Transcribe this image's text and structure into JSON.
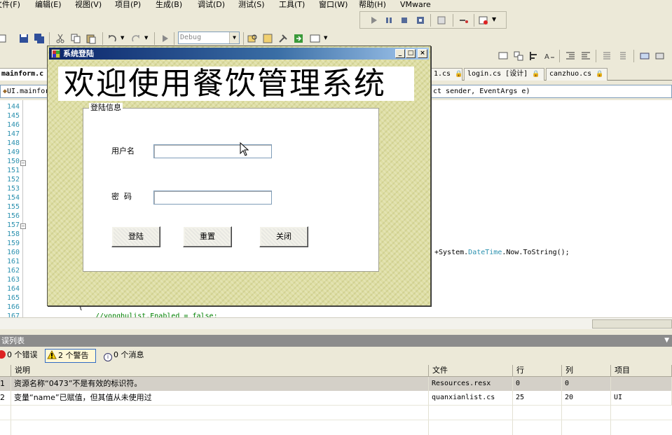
{
  "menu": {
    "items": [
      "文件(F)",
      "编辑(E)",
      "视图(V)",
      "项目(P)",
      "生成(B)",
      "调试(D)",
      "测试(S)",
      "工具(T)",
      "窗口(W)",
      "帮助(H)",
      "VMware"
    ]
  },
  "toolbar": {
    "config": "Debug"
  },
  "tabs": {
    "active": "mainform.c",
    "items": [
      "1.cs",
      "login.cs [设计]",
      "canzhuo.cs"
    ]
  },
  "nav": {
    "left": "UI.mainform",
    "right": "ct sender, EventArgs e)"
  },
  "editor": {
    "line_numbers": [
      "144",
      "145",
      "146",
      "147",
      "148",
      "149",
      "150",
      "151",
      "152",
      "153",
      "154",
      "155",
      "156",
      "157",
      "158",
      "159",
      "160",
      "161",
      "162",
      "163",
      "164",
      "165",
      "166",
      "167"
    ],
    "code_line_160_prefix": "+System.",
    "code_line_160_type": "DateTime",
    "code_line_160_mid": ".Now.ToString();",
    "code_brace": "{",
    "code_comment": "//yonghulist.Enabled = false;"
  },
  "errorlist": {
    "title": "误列表",
    "filters": {
      "errors": "0 个错误",
      "warnings": "2 个警告",
      "messages": "0 个消息"
    },
    "columns": [
      "",
      "说明",
      "文件",
      "行",
      "列",
      "项目"
    ],
    "rows": [
      {
        "num": "1",
        "desc": "资源名称“0473”不是有效的标识符。",
        "file": "Resources.resx",
        "line": "0",
        "col": "0",
        "project": ""
      },
      {
        "num": "2",
        "desc": "变量“name”已赋值，但其值从未使用过",
        "file": "quanxianlist.cs",
        "line": "25",
        "col": "20",
        "project": "UI"
      }
    ]
  },
  "dialog": {
    "title": "系统登陆",
    "banner": "欢迎使用餐饮管理系统",
    "group_label": "登陆信息",
    "username_label": "用户名",
    "password_label": "密  码",
    "username_value": "",
    "password_value": "",
    "buttons": {
      "login": "登陆",
      "reset": "重置",
      "close": "关闭"
    }
  },
  "colors": {
    "dialog_bg": "#dedea4",
    "titlebar": "#0a246a",
    "line_number": "#2b91af",
    "comment": "#008000"
  }
}
